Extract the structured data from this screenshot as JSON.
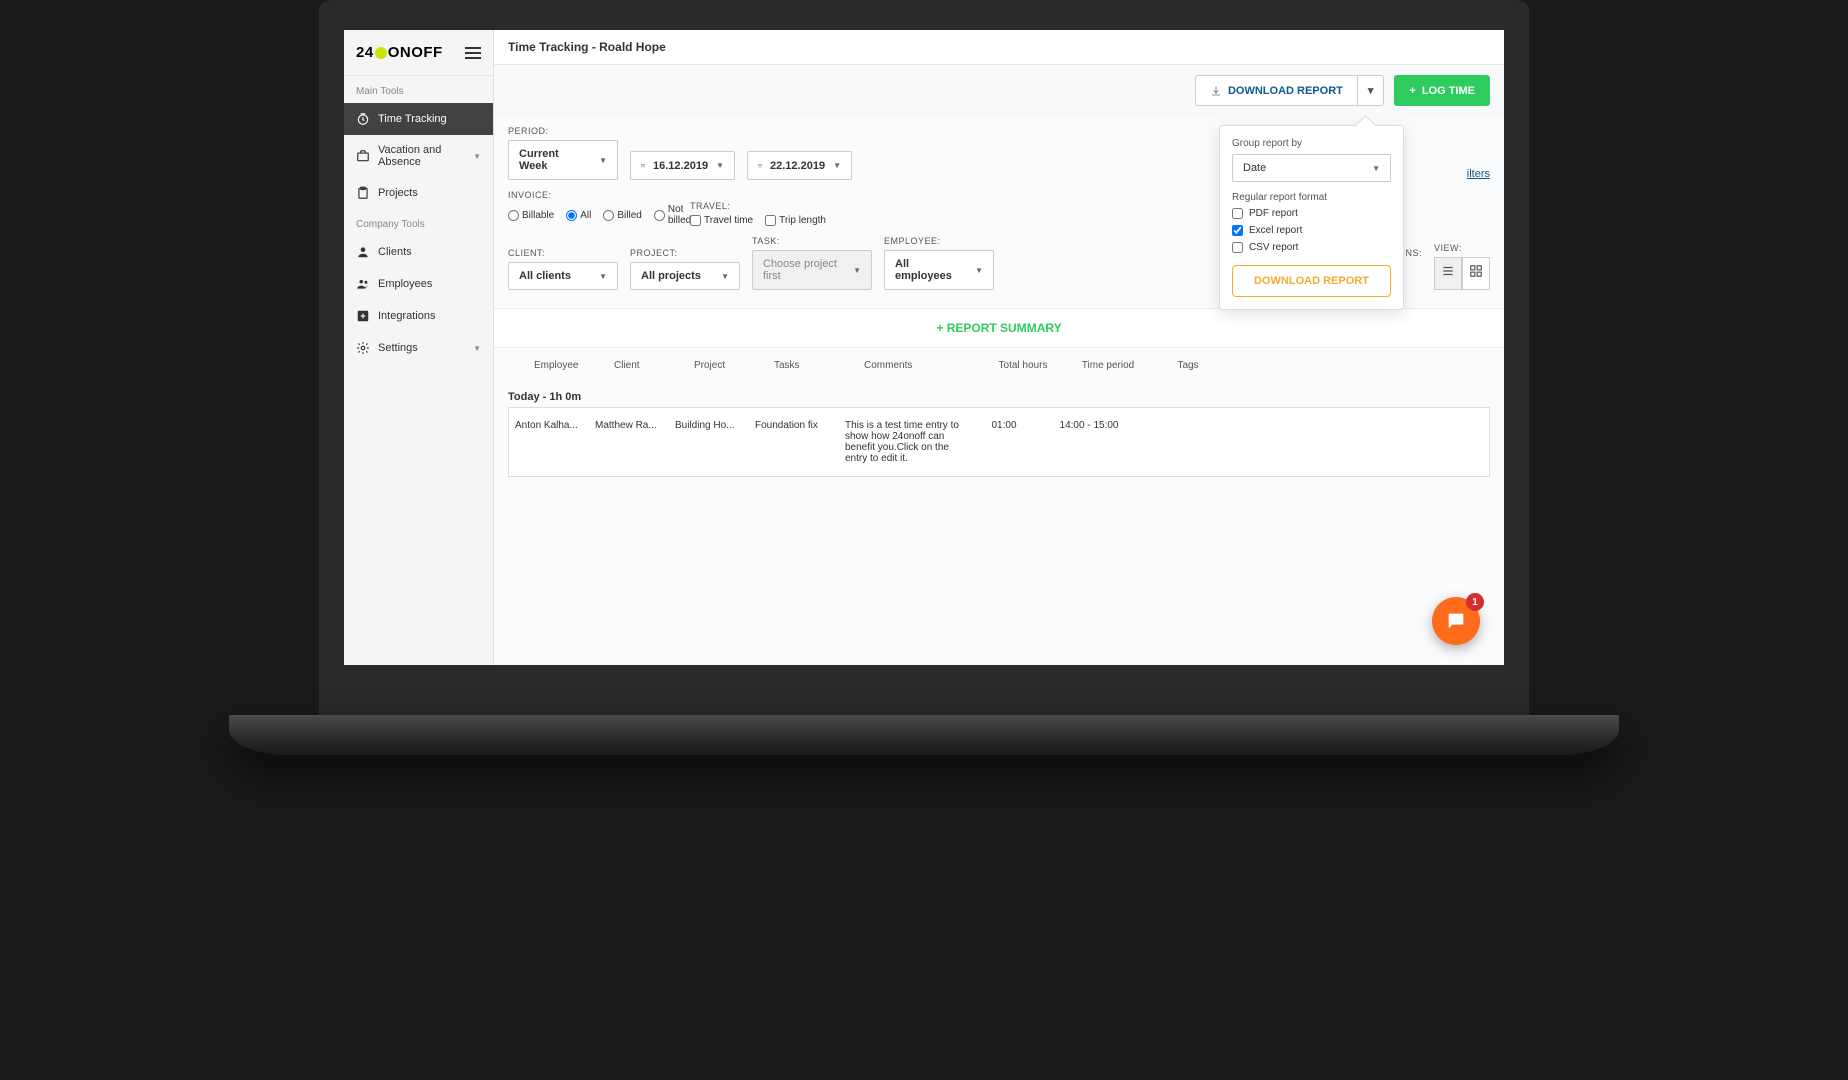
{
  "logo": {
    "prefix": "24",
    "suffix": "ONOFF"
  },
  "sidebar": {
    "section_main": "Main Tools",
    "section_company": "Company Tools",
    "items_main": [
      {
        "label": "Time Tracking",
        "icon": "clock-icon",
        "active": true
      },
      {
        "label": "Vacation and Absence",
        "icon": "briefcase-icon",
        "caret": true
      },
      {
        "label": "Projects",
        "icon": "clipboard-icon"
      }
    ],
    "items_company": [
      {
        "label": "Clients",
        "icon": "user-icon"
      },
      {
        "label": "Employees",
        "icon": "users-icon"
      },
      {
        "label": "Integrations",
        "icon": "plus-box-icon"
      },
      {
        "label": "Settings",
        "icon": "gear-icon",
        "caret": true
      }
    ]
  },
  "header": {
    "title": "Time Tracking - Roald Hope"
  },
  "toolbar": {
    "download_label": "DOWNLOAD REPORT",
    "logtime_label": "LOG TIME"
  },
  "filters": {
    "period_label": "PERIOD:",
    "period_value": "Current Week",
    "date_from": "16.12.2019",
    "date_to": "22.12.2019",
    "invoice_label": "INVOICE:",
    "invoice_options": {
      "billable": "Billable",
      "all": "All",
      "billed": "Billed",
      "not_billed": "Not billed"
    },
    "travel_label": "TRAVEL:",
    "travel_options": {
      "time": "Travel time",
      "length": "Trip length"
    },
    "client_label": "CLIENT:",
    "client_value": "All clients",
    "project_label": "PROJECT:",
    "project_value": "All projects",
    "task_label": "TASK:",
    "task_value": "Choose project first",
    "employee_label": "EMPLOYEE:",
    "employee_value": "All employees",
    "ns_label": "NS:",
    "view_label": "VIEW:",
    "reset_link": "ilters"
  },
  "summary": {
    "label": "REPORT SUMMARY"
  },
  "table": {
    "headers": {
      "employee": "Employee",
      "client": "Client",
      "project": "Project",
      "tasks": "Tasks",
      "comments": "Comments",
      "total_hours": "Total hours",
      "time_period": "Time period",
      "tags": "Tags"
    },
    "day_label": "Today - 1h 0m",
    "rows": [
      {
        "employee": "Anton Kalha...",
        "client": "Matthew Ra...",
        "project": "Building Ho...",
        "task": "Foundation fix",
        "comment": "This is a test time entry to show how 24onoff can benefit you.Click on the entry to edit it.",
        "hours": "01:00",
        "period": "14:00 - 15:00",
        "tags": ""
      }
    ]
  },
  "popup": {
    "group_label": "Group report by",
    "group_value": "Date",
    "format_label": "Regular report format",
    "opt_pdf": "PDF report",
    "opt_excel": "Excel report",
    "opt_csv": "CSV report",
    "button": "DOWNLOAD REPORT"
  },
  "chat": {
    "badge": "1"
  }
}
